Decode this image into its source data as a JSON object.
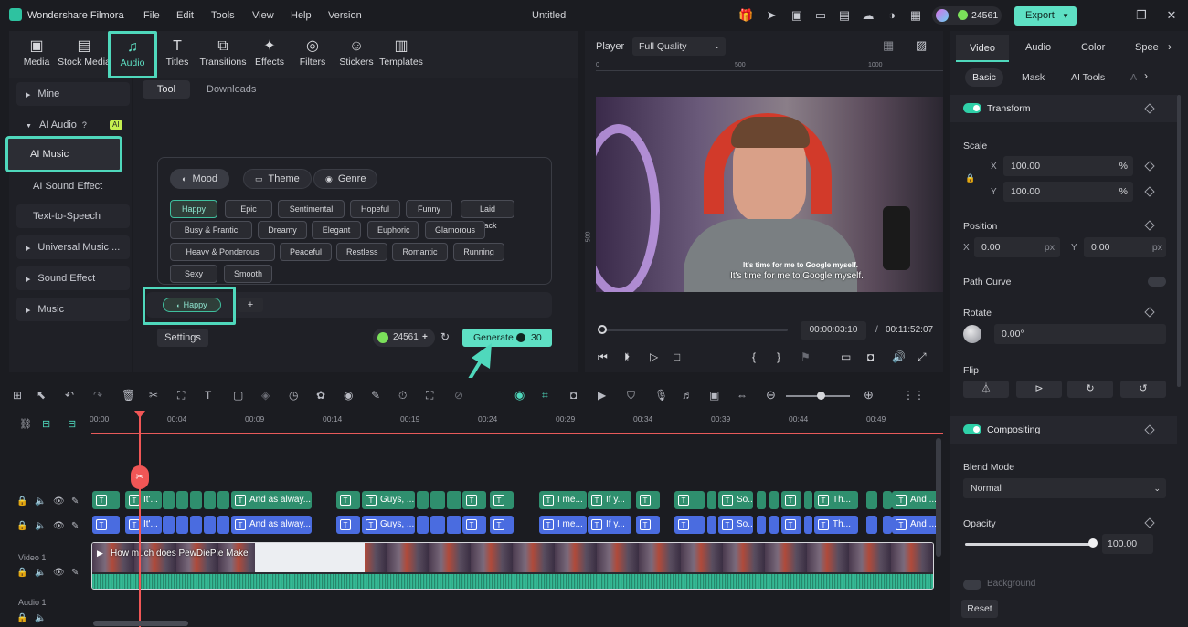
{
  "app": {
    "name": "Wondershare Filmora",
    "doc_title": "Untitled",
    "credits": "24561",
    "export_label": "Export"
  },
  "menu": [
    "File",
    "Edit",
    "Tools",
    "View",
    "Help",
    "Version"
  ],
  "toolbar": [
    "Media",
    "Stock Media",
    "Audio",
    "Titles",
    "Transitions",
    "Effects",
    "Filters",
    "Stickers",
    "Templates"
  ],
  "sidebar": {
    "mine": "Mine",
    "ai_audio": "AI Audio",
    "ai_badge": "AI",
    "ai_music": "AI Music",
    "ai_sound_effect": "AI Sound Effect",
    "tts": "Text-to-Speech",
    "universal_music": "Universal Music ...",
    "sound_effect": "Sound Effect",
    "music": "Music"
  },
  "content": {
    "tabs": [
      "Tool",
      "Downloads"
    ],
    "filter_tabs": [
      "Mood",
      "Theme",
      "Genre"
    ],
    "moods": [
      [
        "Happy",
        "Epic",
        "Sentimental",
        "Hopeful",
        "Funny",
        "Laid Back"
      ],
      [
        "Busy & Frantic",
        "Dreamy",
        "Elegant",
        "Euphoric",
        "Glamorous"
      ],
      [
        "Heavy & Ponderous",
        "Peaceful",
        "Restless",
        "Romantic",
        "Running"
      ],
      [
        "Sexy",
        "Smooth"
      ]
    ],
    "selected_tag": "Happy",
    "add": "+",
    "settings": "Settings",
    "credits": "24561",
    "generate": "Generate",
    "generate_cost": "30"
  },
  "player": {
    "label": "Player",
    "quality": "Full Quality",
    "ruler": [
      "0",
      "500",
      "1000"
    ],
    "vruler": "500",
    "subtitle1": "It's time for me to Google myself.",
    "subtitle2": "It's time for me to Google myself.",
    "current_time": "00:00:03:10",
    "separator": "/",
    "total_time": "00:11:52:07",
    "brace_open": "{",
    "brace_close": "}"
  },
  "props": {
    "tabs": [
      "Video",
      "Audio",
      "Color",
      "Spee"
    ],
    "subtabs": [
      "Basic",
      "Mask",
      "AI Tools",
      "A"
    ],
    "transform": "Transform",
    "scale": "Scale",
    "scale_x_label": "X",
    "scale_x": "100.00",
    "scale_y_label": "Y",
    "scale_y": "100.00",
    "pct": "%",
    "position": "Position",
    "pos_x_label": "X",
    "pos_x": "0.00",
    "pos_y_label": "Y",
    "pos_y": "0.00",
    "px": "px",
    "path_curve": "Path Curve",
    "rotate": "Rotate",
    "rotate_value": "0.00°",
    "flip": "Flip",
    "compositing": "Compositing",
    "blend_mode": "Blend Mode",
    "blend_value": "Normal",
    "opacity": "Opacity",
    "opacity_value": "100.00",
    "opacity_level": 1.0,
    "background": "Background",
    "reset": "Reset"
  },
  "timeline": {
    "ticks": [
      "00:00",
      "00:04",
      "00:09",
      "00:14",
      "00:19",
      "00:24",
      "00:29",
      "00:34",
      "00:39",
      "00:44",
      "00:49"
    ],
    "video_track": "Video 1",
    "audio_track": "Audio 1",
    "video_clip_title": "How much does PewDiePie Make",
    "title_clips": [
      "It'...",
      "And as alway...",
      "Guys, ...",
      "I me...",
      "If y...",
      "So...",
      "Th...",
      "And ..."
    ],
    "clip_glyph": "T"
  },
  "colors": {
    "accent": "#4fd8bc",
    "text_clip": "#2f8f6e",
    "subtitle_clip": "#4a6ce0",
    "playhead": "#f05656",
    "background": "#1b1c21"
  }
}
